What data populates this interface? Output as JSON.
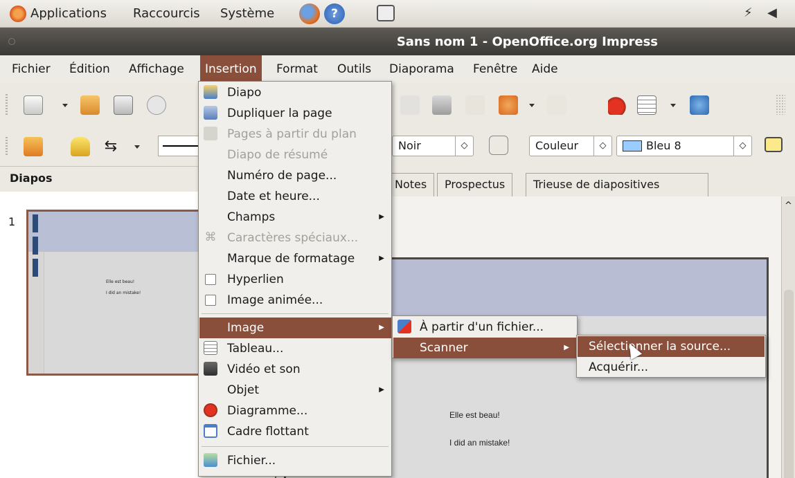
{
  "panel": {
    "applications": "Applications",
    "raccourcis": "Raccourcis",
    "systeme": "Système"
  },
  "window": {
    "title": "Sans nom 1 - OpenOffice.org Impress"
  },
  "menubar": {
    "items": [
      "Fichier",
      "Édition",
      "Affichage",
      "Insertion",
      "Format",
      "Outils",
      "Diaporama",
      "Fenêtre",
      "Aide"
    ]
  },
  "toolbar2": {
    "line_color": "Noir",
    "area_style": "Couleur",
    "area_color": "Bleu 8"
  },
  "left_panel": {
    "title": "Diapos",
    "slide_number": "1"
  },
  "view_tabs": [
    "Notes",
    "Prospectus",
    "Trieuse de diapositives"
  ],
  "slide": {
    "line1": "Elle est beau!",
    "line2": "I did an mistake!"
  },
  "insert_menu": {
    "items": [
      {
        "label": "Diapo",
        "icon": "slide-icon"
      },
      {
        "label": "Dupliquer la page",
        "icon": "duplicate-icon"
      },
      {
        "label": "Pages à partir du plan",
        "icon": "outline-icon",
        "disabled": true
      },
      {
        "label": "Diapo de résumé",
        "disabled": true
      },
      {
        "label": "Numéro de page..."
      },
      {
        "label": "Date et heure..."
      },
      {
        "label": "Champs",
        "submenu": true
      },
      {
        "label": "Caractères spéciaux...",
        "icon": "special-char-icon",
        "disabled": true
      },
      {
        "label": "Marque de formatage",
        "submenu": true
      },
      {
        "label": "Hyperlien",
        "checkbox": true
      },
      {
        "label": "Image animée...",
        "checkbox": true
      },
      {
        "label": "Image",
        "submenu": true,
        "highlighted": true
      },
      {
        "label": "Tableau...",
        "icon": "table-icon"
      },
      {
        "label": "Vidéo et son",
        "icon": "film-icon"
      },
      {
        "label": "Objet",
        "submenu": true
      },
      {
        "label": "Diagramme...",
        "icon": "chart-icon"
      },
      {
        "label": "Cadre flottant",
        "icon": "frame-icon"
      },
      {
        "label": "Fichier...",
        "icon": "file-icon"
      }
    ]
  },
  "image_submenu": {
    "items": [
      {
        "label": "À partir d'un fichier...",
        "icon": "picture-icon"
      },
      {
        "label": "Scanner",
        "submenu": true,
        "highlighted": true
      }
    ]
  },
  "scanner_submenu": {
    "items": [
      {
        "label": "Sélectionner la source...",
        "highlighted": true
      },
      {
        "label": "Acquérir..."
      }
    ]
  },
  "colors": {
    "accent": "#8a4f3b",
    "title_bar": "#3b3935",
    "slide_header": "#b8bdd4",
    "line_color_swatch": "#000000",
    "area_color_swatch": "#99ccff"
  }
}
